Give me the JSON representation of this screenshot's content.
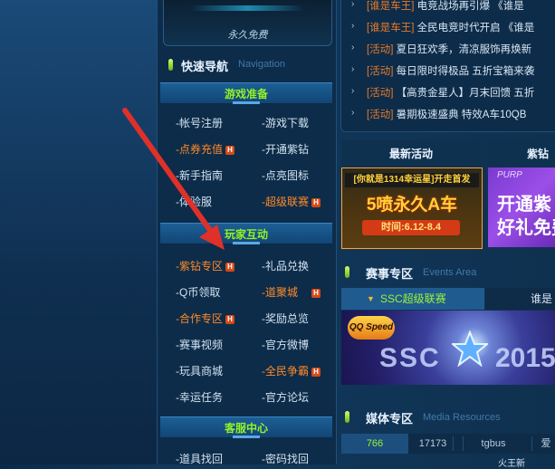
{
  "free_box": {
    "label": "永久免费"
  },
  "quick_nav": {
    "title": "快速导航",
    "subtitle": "Navigation",
    "sections": [
      {
        "title": "游戏准备",
        "links": [
          [
            "-帐号注册",
            "-游戏下载"
          ],
          [
            "-点券充值",
            "-开通紫钻"
          ],
          [
            "-新手指南",
            "-点亮图标"
          ],
          [
            "-体验服",
            "-超级联赛"
          ]
        ]
      },
      {
        "title": "玩家互动",
        "links": [
          [
            "-紫钻专区",
            "-礼品兑换"
          ],
          [
            "-Q币领取",
            "-道聚城"
          ],
          [
            "-合作专区",
            "-奖励总览"
          ],
          [
            "-赛事视频",
            "-官方微博"
          ],
          [
            "-玩具商城",
            "-全民争霸"
          ],
          [
            "-幸运任务",
            "-官方论坛"
          ]
        ]
      },
      {
        "title": "客服中心",
        "links": [
          [
            "-道具找回",
            "-密码找回"
          ]
        ]
      }
    ],
    "hot_badge": "H"
  },
  "news": [
    {
      "tag": "[谁是车王]",
      "text": "电竞战场再引爆 《谁是"
    },
    {
      "tag": "[谁是车王]",
      "text": "全民电竞时代开启 《谁是"
    },
    {
      "tag": "[活动]",
      "text": "夏日狂欢季，清凉服饰再焕新"
    },
    {
      "tag": "[活动]",
      "text": "每日限时得极品 五折宝箱来袭"
    },
    {
      "tag": "[活动]",
      "text": "【高贵金星人】月末回馈 五折"
    },
    {
      "tag": "[活动]",
      "text": "暑期极速盛典 特效A车10QB"
    }
  ],
  "promo": {
    "latest_title": "最新活动",
    "right_title": "紫钻",
    "banner1": {
      "top": "[你就是1314幸运星]开走首发",
      "main": "5喷永久A车",
      "date": "时间:6.12-8.4"
    },
    "banner2": {
      "purp": "PURP",
      "line1": "开通紫",
      "line2": "好礼免费"
    }
  },
  "events": {
    "title": "赛事专区",
    "subtitle": "Events Area",
    "tab_active": "SSC超级联赛",
    "tab_other": "谁是",
    "banner_logo": "QQ Speed",
    "banner_text": "SSC",
    "banner_year": "2015"
  },
  "media": {
    "title": "媒体专区",
    "subtitle": "Media Resources",
    "tabs": [
      "766",
      "17173",
      "tgbus",
      "爱"
    ],
    "bottom_text": "火王新"
  }
}
